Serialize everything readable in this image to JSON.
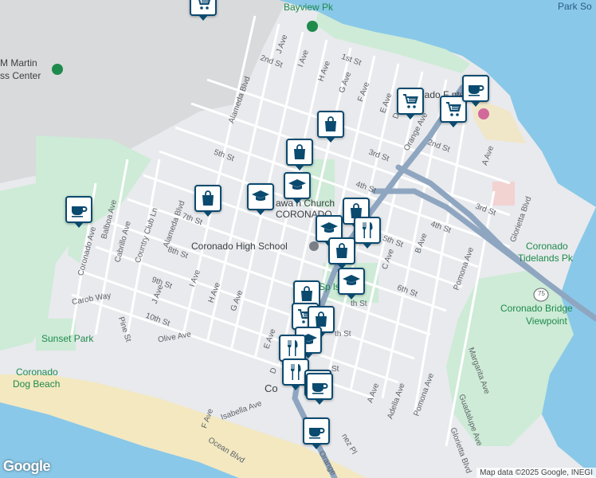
{
  "map": {
    "attribution": "Map data ©2025 Google, INEGI",
    "logo": "Google",
    "places": {
      "bayview_pk": "Bayview Pk",
      "park_so": "Park So",
      "martin_center_line1": "M Martin",
      "martin_center_line2": "ss Center",
      "coronado_ferry_center": "Coronado F    nter",
      "coronado_high_school": "Coronado High School",
      "church_line1": "awa    n Church",
      "church_line2": "CORONADO",
      "spreckels_pk": "Sp     ls Pk",
      "sunset_park": "Sunset Park",
      "coronado_dog_beach_line1": "Coronado",
      "coronado_dog_beach_line2": "Dog Beach",
      "coronado_tidelands_line1": "Coronado",
      "coronado_tidelands_line2": "Tidelands Pk",
      "coronado_bridge_line1": "Coronado Bridge",
      "coronado_bridge_line2": "Viewpoint",
      "coronado_town": "Co",
      "route_75": "75"
    },
    "streets": {
      "first_st": "1st St",
      "second_st": "2nd St",
      "second_st_east": "2nd St",
      "third_st": "3rd St",
      "third_st_east": "3rd St",
      "fourth_st": "4th St",
      "fourth_st_east": "4th St",
      "fifth_st": "5th St",
      "fifth_st_east": "5th St",
      "sixth_st": "6th St",
      "seventh_st": "7th St",
      "eighth_st": "8th St",
      "ninth_st": "9th St",
      "tenth_st": "10th St",
      "j_ave_north": "J Ave",
      "i_ave_north": "I Ave",
      "h_ave_north": "H Ave",
      "g_ave_north": "G Ave",
      "f_ave_north": "F Ave",
      "e_ave_north": "E Ave",
      "d_ave_north": "D",
      "orange_ave": "Orange Ave",
      "a_ave_east": "A Ave",
      "alameda_blvd_north": "Alameda Blvd",
      "alameda_blvd_south": "Alameda Blvd",
      "balboa_ave": "Balboa Ave",
      "cabrillo_ave": "Cabrillo Ave",
      "country_club_ln": "Country Club Ln",
      "coronado_ave": "Coronado Ave",
      "carob_way": "Carob Way",
      "pine_st": "Pine St",
      "olive_ave": "Olive Ave",
      "j_ave": "J Ave",
      "i_ave": "I Ave",
      "h_ave": "H Ave",
      "g_ave": "G Ave",
      "e_ave": "E Ave",
      "d_ave": "D",
      "c_ave": "C Ave",
      "b_ave": "B Ave",
      "a_ave": "A Ave",
      "adella_ave": "Adella Ave",
      "pomona_ave": "Pomona Ave",
      "pomona_ave_south": "Pomona Ave",
      "glorietta_blvd": "Glorietta Blvd",
      "glorietta_blvd_south": "Glorietta Blvd",
      "margarita_ave": "Margarita Ave",
      "guadalupe_ave": "Guadalupe Ave",
      "isabella_ave": "Isabella Ave",
      "ocean_blvd": "Ocean Blvd",
      "f_ave_south": "F Ave",
      "orange_south": "Orange",
      "inez_pl": "nez Pl",
      "th_st_center": "th St",
      "th_st_center2": "th St",
      "st_near_orange": "St"
    },
    "markers": [
      {
        "type": "shopping-cart",
        "color": "#0b4a6f"
      },
      {
        "type": "coffee-cup",
        "color": "#0b4a6f"
      },
      {
        "type": "shopping-cart",
        "color": "#0b4a6f"
      },
      {
        "type": "shopping-cart",
        "color": "#0b4a6f"
      },
      {
        "type": "coffee-cup",
        "color": "#0b4a6f"
      },
      {
        "type": "shopping-bag",
        "color": "#0b4a6f"
      },
      {
        "type": "shopping-bag",
        "color": "#0b4a6f"
      },
      {
        "type": "coffee-cup",
        "color": "#0b4a6f"
      },
      {
        "type": "shopping-bag",
        "color": "#0b4a6f"
      },
      {
        "type": "graduation-cap",
        "color": "#0b4a6f"
      },
      {
        "type": "graduation-cap",
        "color": "#0b4a6f"
      },
      {
        "type": "shopping-bag",
        "color": "#0b4a6f"
      },
      {
        "type": "graduation-cap",
        "color": "#0b4a6f"
      },
      {
        "type": "fork-knife",
        "color": "#0b4a6f"
      },
      {
        "type": "shopping-bag",
        "color": "#0b4a6f"
      },
      {
        "type": "graduation-cap",
        "color": "#0b4a6f"
      },
      {
        "type": "shopping-bag",
        "color": "#0b4a6f"
      },
      {
        "type": "shopping-cart",
        "color": "#0b4a6f"
      },
      {
        "type": "shopping-bag",
        "color": "#0b4a6f"
      },
      {
        "type": "graduation-cap",
        "color": "#0b4a6f"
      },
      {
        "type": "fork-knife",
        "color": "#0b4a6f"
      },
      {
        "type": "fork-knife",
        "color": "#0b4a6f"
      },
      {
        "type": "coffee-cup",
        "color": "#0b4a6f"
      },
      {
        "type": "coffee-cup",
        "color": "#0b4a6f"
      }
    ]
  }
}
